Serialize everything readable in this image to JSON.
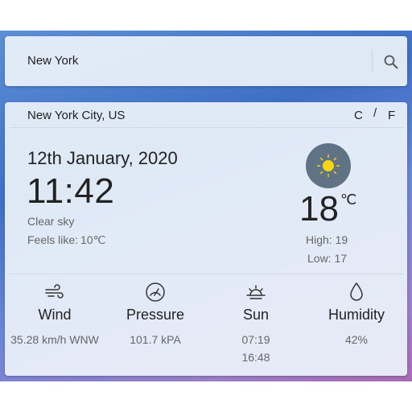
{
  "search": {
    "value": "New York",
    "button_icon": "search-icon"
  },
  "weather": {
    "location": "New York City, US",
    "units": {
      "c": "C",
      "separator": "/",
      "f": "F"
    },
    "date": "12th January, 2020",
    "time": "11:42",
    "description": "Clear sky",
    "feels_label": "Feels like:",
    "feels_value": "10℃",
    "icon": "sun-icon",
    "temperature": "18",
    "temperature_unit": "℃",
    "high": "High: 19",
    "low": "Low: 17"
  },
  "stats": {
    "wind": {
      "icon": "wind-icon",
      "label": "Wind",
      "value": "35.28 km/h WNW"
    },
    "pressure": {
      "icon": "gauge-icon",
      "label": "Pressure",
      "value": "101.7 kPA"
    },
    "sun": {
      "icon": "sunrise-icon",
      "label": "Sun",
      "sunrise": "07:19",
      "sunset": "16:48"
    },
    "humidity": {
      "icon": "droplet-icon",
      "label": "Humidity",
      "value": "42%"
    }
  },
  "colors": {
    "icon_circle": "#5f7385",
    "sun": "#f5d514",
    "secondary_text": "#666666"
  }
}
